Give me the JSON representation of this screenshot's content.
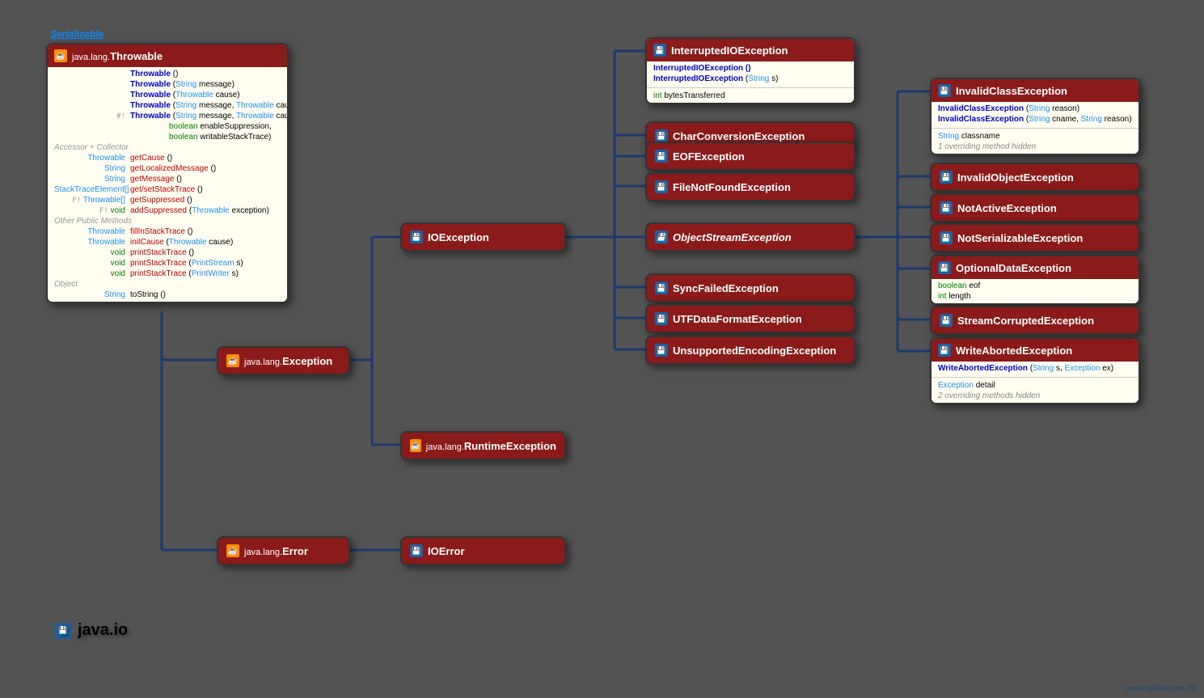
{
  "interface_label": "Serializable",
  "package_label": "java.io",
  "credit": "www.falkhausen.de",
  "throwable": {
    "pkg": "java.lang.",
    "name": "Throwable",
    "ctors": [
      {
        "lcol": "",
        "sig": "Throwable ()"
      },
      {
        "lcol": "",
        "sig": "Throwable (String message)"
      },
      {
        "lcol": "",
        "sig": "Throwable (Throwable cause)"
      },
      {
        "lcol": "",
        "sig": "Throwable (String message, Throwable cause)"
      },
      {
        "lcol": "#!",
        "sig": "Throwable (String message, Throwable cause,",
        "cont1": "boolean enableSuppression,",
        "cont2": "boolean writableStackTrace)"
      }
    ],
    "sec1": "Accessor + Collector",
    "accessors": [
      {
        "ret": "Throwable",
        "name": "getCause ()"
      },
      {
        "ret": "String",
        "name": "getLocalizedMessage ()"
      },
      {
        "ret": "String",
        "name": "getMessage ()"
      },
      {
        "ret": "StackTraceElement[]",
        "name": "get/setStackTrace ()"
      },
      {
        "flag": "F!",
        "ret": "Throwable[]",
        "name": "getSuppressed ()"
      },
      {
        "flag": "F!",
        "ret": "void",
        "name": "addSuppressed (Throwable exception)",
        "arg": "(Throwable exception)"
      }
    ],
    "sec2": "Other Public Methods",
    "methods": [
      {
        "ret": "Throwable",
        "name": "fillInStackTrace ()"
      },
      {
        "ret": "Throwable",
        "name": "initCause",
        "arg": "(Throwable cause)"
      },
      {
        "ret": "void",
        "name": "printStackTrace ()"
      },
      {
        "ret": "void",
        "name": "printStackTrace",
        "arg": "(PrintStream s)"
      },
      {
        "ret": "void",
        "name": "printStackTrace",
        "arg": "(PrintWriter s)"
      }
    ],
    "sec3": "Object",
    "object": [
      {
        "ret": "String",
        "name": "toString ()"
      }
    ]
  },
  "exception": {
    "pkg": "java.lang.",
    "name": "Exception"
  },
  "runtime": {
    "pkg": "java.lang.",
    "name": "RuntimeException"
  },
  "error": {
    "pkg": "java.lang.",
    "name": "Error"
  },
  "ioexception": {
    "name": "IOException"
  },
  "ioerror": {
    "name": "IOError"
  },
  "interrupted": {
    "name": "InterruptedIOException",
    "c1": "InterruptedIOException ()",
    "c2": "InterruptedIOException (String s)",
    "f1": "int bytesTransferred"
  },
  "charconv": {
    "name": "CharConversionException"
  },
  "eof": {
    "name": "EOFException"
  },
  "fnf": {
    "name": "FileNotFoundException"
  },
  "ose": {
    "name": "ObjectStreamException"
  },
  "sfe": {
    "name": "SyncFailedException"
  },
  "utf": {
    "name": "UTFDataFormatException"
  },
  "unsup": {
    "name": "UnsupportedEncodingException"
  },
  "invclass": {
    "name": "InvalidClassException",
    "c1": "InvalidClassException (String reason)",
    "c2": "InvalidClassException (String cname, String reason)",
    "f1": "String classname",
    "note": "1 overriding method hidden"
  },
  "invobj": {
    "name": "InvalidObjectException"
  },
  "notactive": {
    "name": "NotActiveException"
  },
  "notser": {
    "name": "NotSerializableException"
  },
  "optdata": {
    "name": "OptionalDataException",
    "f1": "boolean eof",
    "f2": "int length"
  },
  "scorrupt": {
    "name": "StreamCorruptedException"
  },
  "wabort": {
    "name": "WriteAbortedException",
    "c1": "WriteAbortedException (String s, Exception ex)",
    "f1": "Exception detail",
    "note": "2 overriding methods hidden"
  }
}
